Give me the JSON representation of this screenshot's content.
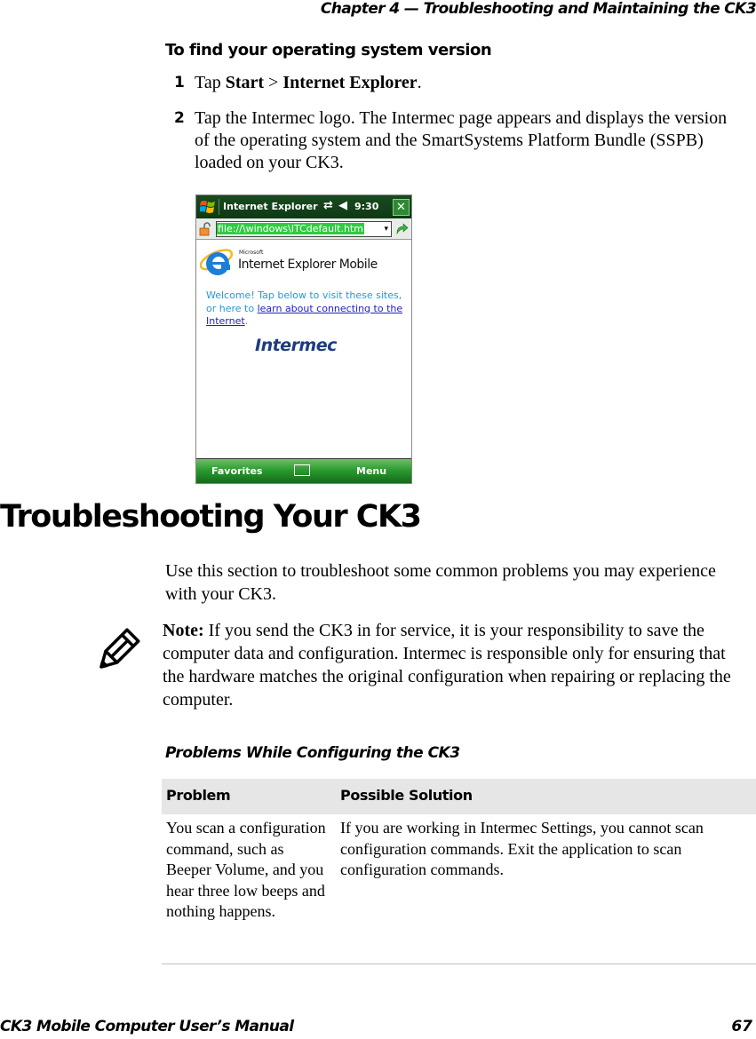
{
  "header": {
    "chapter": "Chapter 4 — Troubleshooting and Maintaining the CK3"
  },
  "procedure": {
    "title": "To find your operating system version",
    "steps": [
      {
        "num": "1",
        "pre": "Tap ",
        "b1": "Start",
        "mid": " > ",
        "b2": "Internet Explorer",
        "post": "."
      },
      {
        "num": "2",
        "text": "Tap the Intermec logo. The Intermec page appears and displays the version of the operating system and the SmartSystems Platform Bundle (SSPB) loaded on your CK3."
      }
    ]
  },
  "device": {
    "title": "Internet Explorer",
    "time": "9:30",
    "close": "✕",
    "sync_icon": "⇄",
    "volume_icon": "◀",
    "address": "file://\\windows\\ITCdefault.htm",
    "dropdown_icon": "▾",
    "ms_label": "Microsoft",
    "ie_title": "Internet Explorer Mobile",
    "welcome_pre": "Welcome! Tap below to visit these sites, or here to ",
    "welcome_link": "learn about connecting to the Internet",
    "welcome_post": ".",
    "intermec_logo": "Intermec",
    "softkey_left": "Favorites",
    "softkey_right": "Menu"
  },
  "section": {
    "title": "Troubleshooting Your CK3",
    "intro": "Use this section to troubleshoot some common problems you may experience with your CK3."
  },
  "note": {
    "label": "Note:",
    "text": " If you send the CK3 in for service, it is your responsibility to save the computer data and configuration. Intermec is responsible only for ensuring that the hardware matches the original configuration when repairing or replacing the computer."
  },
  "table": {
    "title": "Problems While Configuring the CK3",
    "headers": [
      "Problem",
      "Possible Solution"
    ],
    "rows": [
      {
        "problem": "You scan a configuration command, such as Beeper Volume, and you hear three low beeps and nothing happens.",
        "solution": "If you are working in Intermec Settings, you cannot scan configuration commands. Exit the application to scan configuration commands."
      }
    ]
  },
  "footer": {
    "manual": "CK3 Mobile Computer User’s Manual",
    "page": "67"
  }
}
